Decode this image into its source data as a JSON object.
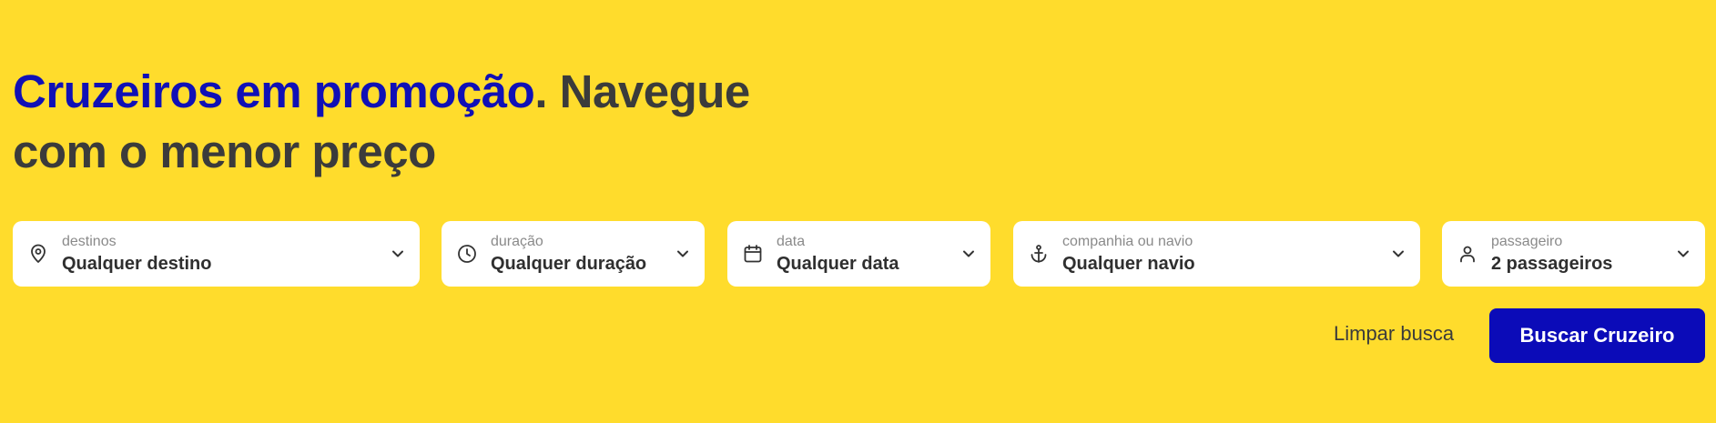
{
  "hero": {
    "headline_accent": "Cruzeiros em promoção",
    "headline_rest": ". Navegue com o menor preço"
  },
  "filters": [
    {
      "label": "destinos",
      "value": "Qualquer destino",
      "icon": "location-pin-icon"
    },
    {
      "label": "duração",
      "value": "Qualquer duração",
      "icon": "clock-icon"
    },
    {
      "label": "data",
      "value": "Qualquer data",
      "icon": "calendar-icon"
    },
    {
      "label": "companhia ou navio",
      "value": "Qualquer navio",
      "icon": "anchor-icon"
    },
    {
      "label": "passageiro",
      "value": "2 passageiros",
      "icon": "person-icon"
    }
  ],
  "actions": {
    "clear_label": "Limpar busca",
    "search_label": "Buscar Cruzeiro"
  },
  "colors": {
    "background": "#ffdc2c",
    "accent_text": "#1010b6",
    "primary_button": "#0b0bb8"
  }
}
